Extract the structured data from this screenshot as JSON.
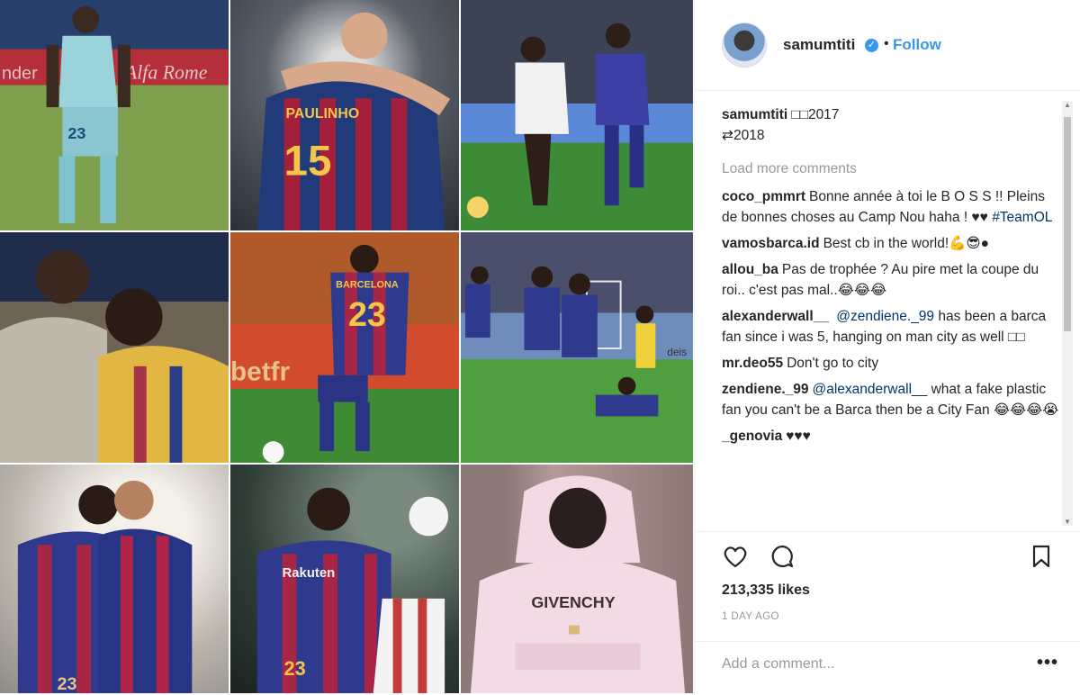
{
  "grid": {
    "tiles": [
      {
        "name": "photo-player-light-blue-kit"
      },
      {
        "name": "photo-team-celebration-hug"
      },
      {
        "name": "photo-match-action"
      },
      {
        "name": "photo-two-players"
      },
      {
        "name": "photo-player-23"
      },
      {
        "name": "photo-goal-celebration"
      },
      {
        "name": "photo-players-embrace"
      },
      {
        "name": "photo-header"
      },
      {
        "name": "photo-pink-hoodie"
      }
    ],
    "texts": {
      "t1_banner_left": "nder",
      "t1_banner_right": "Alfa Rome",
      "t1_number": "23",
      "t2_name": "PAULINHO",
      "t2_number": "15",
      "t5_name": "BARCELONA",
      "t5_number": "23",
      "t5_sponsor": "betfr",
      "t6_sponsor": "deis",
      "t8_sponsor": "Rakuten",
      "t8_number": "23",
      "t9_print": "GIVENCHY",
      "t7_number": "23"
    }
  },
  "post": {
    "username": "samumtiti",
    "verified_icon": "verified-badge-icon",
    "separator": "•",
    "follow_label": "Follow",
    "caption_user": "samumtiti",
    "caption_text": "□□2017",
    "caption_text2": "⇄2018",
    "load_more": "Load more comments",
    "comments": [
      {
        "user": "coco_pmmrt",
        "text": "Bonne année à toi le B O S S !! Pleins de bonnes choses au Camp Nou haha ! ♥♥ ",
        "tag": "#TeamOL"
      },
      {
        "user": "vamosbarca.id",
        "text": "Best cb in the world!💪😎●"
      },
      {
        "user": "allou_ba",
        "text": "Pas de trophée ? Au pire met la coupe du roi.. c'est pas mal..😂😂😂"
      },
      {
        "user": "alexanderwall__",
        "mention": "@zendiene._99",
        "text": " has been a barca fan since i was 5, hanging on man city as well □□"
      },
      {
        "user": "mr.deo55",
        "text": "Don't go to city"
      },
      {
        "user": "zendiene._99",
        "mention": "@alexanderwall__",
        "text": " what a fake plastic fan you can't be a Barca then be a City Fan 😂😂😂😭"
      },
      {
        "user": "_genovia",
        "text": "♥♥♥"
      }
    ],
    "likes": "213,335 likes",
    "time": "1 DAY AGO",
    "add_comment_placeholder": "Add a comment...",
    "more_label": "•••"
  },
  "icons": {
    "like": "heart-icon",
    "comment": "comment-icon",
    "save": "bookmark-icon",
    "options": "more-options-icon"
  },
  "colors": {
    "link_blue": "#3897f0",
    "mention_blue": "#003569",
    "muted_gray": "#999999",
    "text": "#262626"
  }
}
